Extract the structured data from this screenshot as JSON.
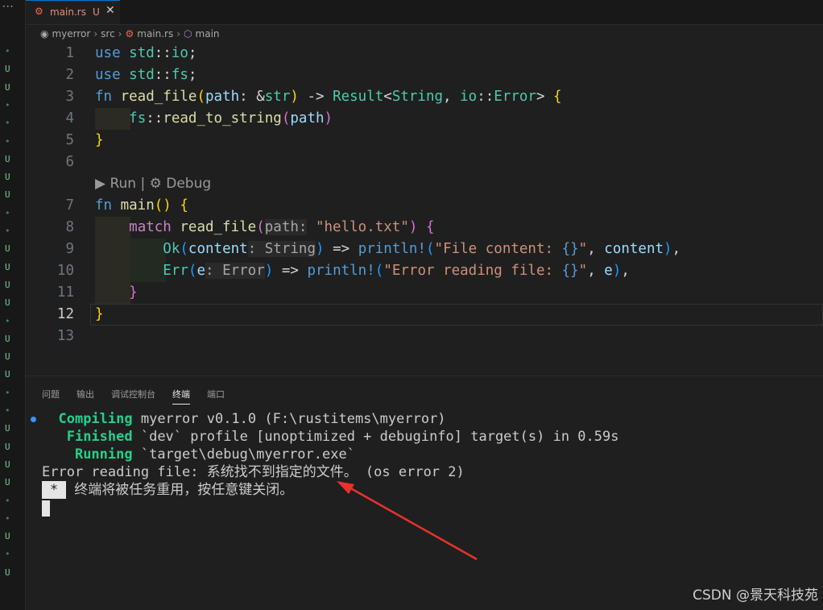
{
  "gutter": {
    "more": "···",
    "marks": [
      {
        "t": "•",
        "c": "d"
      },
      {
        "t": "U",
        "c": "u"
      },
      {
        "t": "U",
        "c": "u"
      },
      {
        "t": "•",
        "c": "d"
      },
      {
        "t": "•",
        "c": "d"
      },
      {
        "t": "•",
        "c": "d"
      },
      {
        "t": "U",
        "c": "u"
      },
      {
        "t": "U",
        "c": "u"
      },
      {
        "t": "U",
        "c": "u"
      },
      {
        "t": "•",
        "c": "d"
      },
      {
        "t": "•",
        "c": "d"
      },
      {
        "t": "U",
        "c": "u"
      },
      {
        "t": "U",
        "c": "u"
      },
      {
        "t": "U",
        "c": "u"
      },
      {
        "t": "U",
        "c": "u"
      },
      {
        "t": "•",
        "c": "d"
      },
      {
        "t": "U",
        "c": "u"
      },
      {
        "t": "U",
        "c": "u"
      },
      {
        "t": "U",
        "c": "u"
      },
      {
        "t": "•",
        "c": "d"
      },
      {
        "t": "•",
        "c": "d"
      },
      {
        "t": "U",
        "c": "u"
      },
      {
        "t": "U",
        "c": "u"
      },
      {
        "t": "U",
        "c": "u"
      },
      {
        "t": "U",
        "c": "u"
      },
      {
        "t": "•",
        "c": "d"
      },
      {
        "t": "•",
        "c": "d"
      },
      {
        "t": "U",
        "c": "u"
      },
      {
        "t": "•",
        "c": "d"
      },
      {
        "t": "U",
        "c": "u"
      }
    ]
  },
  "tab": {
    "file_name": "main.rs",
    "status": "U",
    "close": "✕"
  },
  "breadcrumb": {
    "items": [
      "myerror",
      "src",
      "main.rs",
      "main"
    ]
  },
  "editor": {
    "line_numbers": [
      "1",
      "2",
      "3",
      "4",
      "5",
      "6",
      "7",
      "8",
      "9",
      "10",
      "11",
      "12",
      "13"
    ],
    "active_line": "12",
    "codelens": "▶ Run | ⚙ Debug",
    "lines": [
      [
        [
          "kw",
          "use "
        ],
        [
          "ty",
          "std"
        ],
        [
          "pn",
          "::"
        ],
        [
          "ty",
          "io"
        ],
        [
          "pn",
          ";"
        ]
      ],
      [
        [
          "kw",
          "use "
        ],
        [
          "ty",
          "std"
        ],
        [
          "pn",
          "::"
        ],
        [
          "ty",
          "fs"
        ],
        [
          "pn",
          ";"
        ]
      ],
      [
        [
          "kw",
          "fn "
        ],
        [
          "fn",
          "read_file"
        ],
        [
          "b1",
          "("
        ],
        [
          "var",
          "path"
        ],
        [
          "pn",
          ": &"
        ],
        [
          "ty",
          "str"
        ],
        [
          "b1",
          ")"
        ],
        [
          "pn",
          " -> "
        ],
        [
          "ty",
          "Result"
        ],
        [
          "pn",
          "<"
        ],
        [
          "ty",
          "String"
        ],
        [
          "pn",
          ", "
        ],
        [
          "ty",
          "io"
        ],
        [
          "pn",
          "::"
        ],
        [
          "ty",
          "Error"
        ],
        [
          "pn",
          "> "
        ],
        [
          "b1",
          "{"
        ]
      ],
      [
        [
          "pn",
          "    "
        ],
        [
          "ty",
          "fs"
        ],
        [
          "pn",
          "::"
        ],
        [
          "fn",
          "read_to_string"
        ],
        [
          "b2",
          "("
        ],
        [
          "var",
          "path"
        ],
        [
          "b2",
          ")"
        ]
      ],
      [
        [
          "b1",
          "}"
        ]
      ],
      [],
      [
        [
          "kw",
          "fn "
        ],
        [
          "fn",
          "main"
        ],
        [
          "b1",
          "()"
        ],
        [
          "pn",
          " "
        ],
        [
          "b1",
          "{"
        ]
      ],
      [
        [
          "pn",
          "    "
        ],
        [
          "ctl",
          "match "
        ],
        [
          "fn",
          "read_file"
        ],
        [
          "b2",
          "("
        ],
        [
          "hint",
          "path:"
        ],
        [
          "pn",
          " "
        ],
        [
          "str",
          "\"hello.txt\""
        ],
        [
          "b2",
          ")"
        ],
        [
          "pn",
          " "
        ],
        [
          "b2",
          "{"
        ]
      ],
      [
        [
          "pn",
          "        "
        ],
        [
          "ty",
          "Ok"
        ],
        [
          "b3",
          "("
        ],
        [
          "var",
          "content"
        ],
        [
          "hint",
          ": String"
        ],
        [
          "b3",
          ")"
        ],
        [
          "pn",
          " => "
        ],
        [
          "mac",
          "println!"
        ],
        [
          "b3",
          "("
        ],
        [
          "str",
          "\"File content: "
        ],
        [
          "kw",
          "{}"
        ],
        [
          "str",
          "\""
        ],
        [
          "pn",
          ", "
        ],
        [
          "var",
          "content"
        ],
        [
          "b3",
          ")"
        ],
        [
          "pn",
          ","
        ]
      ],
      [
        [
          "pn",
          "        "
        ],
        [
          "ty",
          "Err"
        ],
        [
          "b3",
          "("
        ],
        [
          "var",
          "e"
        ],
        [
          "hint",
          ": Error"
        ],
        [
          "b3",
          ")"
        ],
        [
          "pn",
          " => "
        ],
        [
          "mac",
          "println!"
        ],
        [
          "b3",
          "("
        ],
        [
          "str",
          "\"Error reading file: "
        ],
        [
          "kw",
          "{}"
        ],
        [
          "str",
          "\""
        ],
        [
          "pn",
          ", "
        ],
        [
          "var",
          "e"
        ],
        [
          "b3",
          ")"
        ],
        [
          "pn",
          ","
        ]
      ],
      [
        [
          "pn",
          "    "
        ],
        [
          "b2",
          "}"
        ]
      ],
      [
        [
          "b1",
          "}"
        ]
      ],
      []
    ]
  },
  "panel": {
    "tabs": [
      "问题",
      "输出",
      "调试控制台",
      "终端",
      "端口"
    ],
    "active_tab": "终端",
    "terminal": {
      "line1_label": "Compiling",
      "line1_text": " myerror v0.1.0 (F:\\rustitems\\myerror)",
      "line2_label": "Finished",
      "line2_text": " `dev` profile [unoptimized + debuginfo] target(s) in 0.59s",
      "line3_label": "Running",
      "line3_text": " `target\\debug\\myerror.exe`",
      "line4": "Error reading file: 系统找不到指定的文件。 (os error 2)",
      "line5_marker": "*",
      "line5_text": " 终端将被任务重用，按任意键关闭。"
    }
  },
  "watermark": "CSDN @景天科技苑",
  "colors": {
    "accent": "#0078d4",
    "terminal_green": "#23d18b",
    "arrow": "#e8332a"
  }
}
